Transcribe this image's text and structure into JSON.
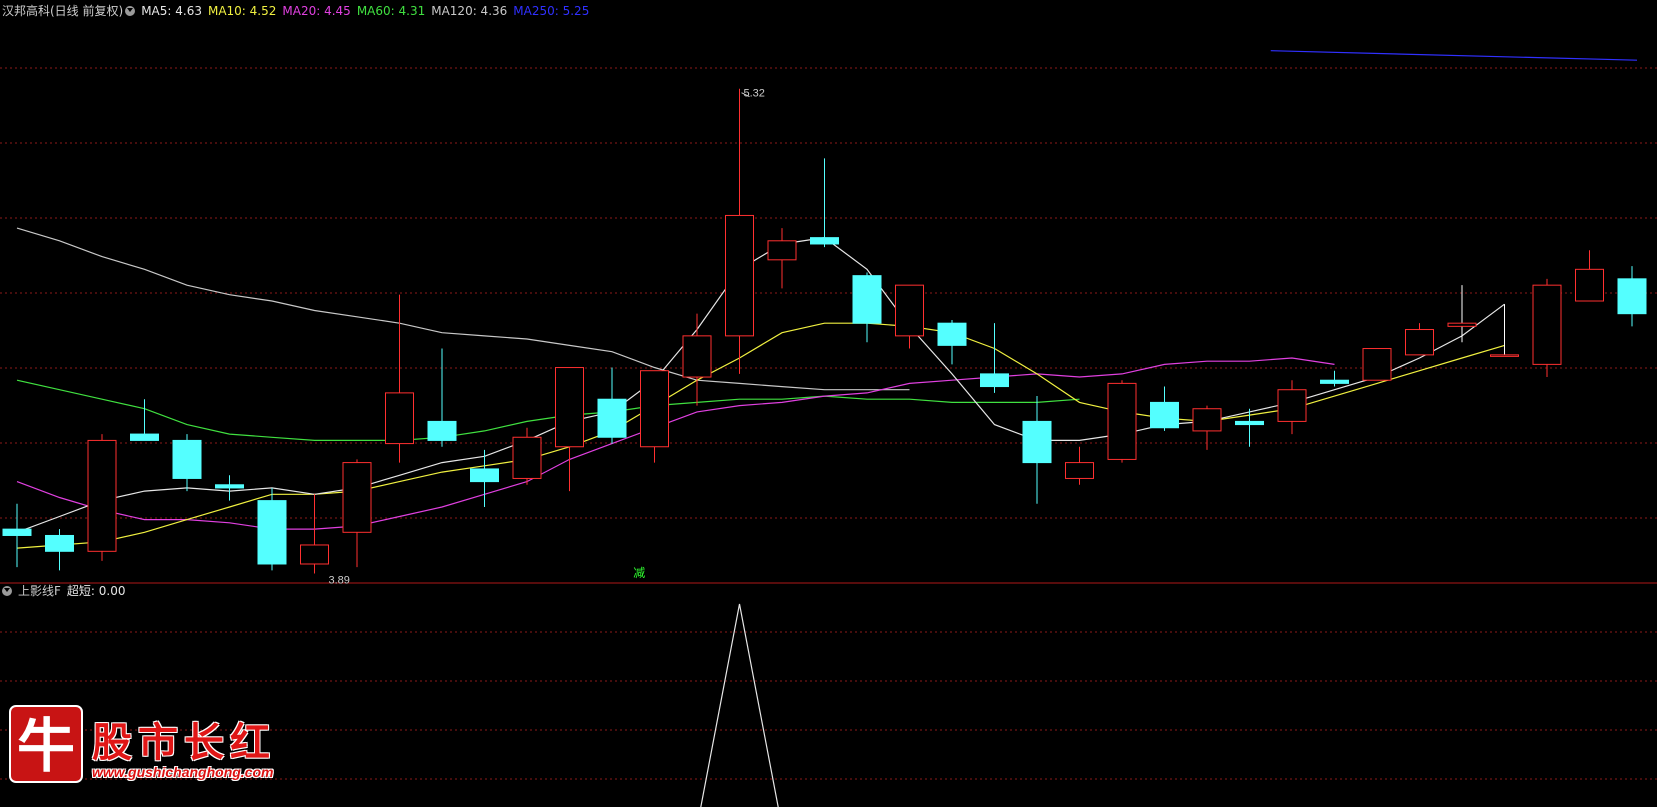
{
  "header": {
    "stock_name": "汉邦高科(日线 前复权)",
    "ma": [
      {
        "label": "MA5: 4.63",
        "color": "#e6e6e6"
      },
      {
        "label": "MA10: 4.52",
        "color": "#f0f040"
      },
      {
        "label": "MA20: 4.45",
        "color": "#e040e0"
      },
      {
        "label": "MA60: 4.31",
        "color": "#40e040"
      },
      {
        "label": "MA120: 4.36",
        "color": "#c8c8c8"
      },
      {
        "label": "MA250: 5.25",
        "color": "#3030ff"
      }
    ]
  },
  "sub_header": {
    "indicator": "上影线F",
    "value_label": "超短: 0.00"
  },
  "annotations": {
    "high_label": "5.32",
    "low_label": "3.89",
    "signal_label": "减"
  },
  "colors": {
    "up": "#ff3030",
    "down": "#54ffff",
    "grid": "#8b1a1a",
    "separator": "#b01818"
  },
  "logo": {
    "name": "股市长红",
    "url": "www.gushichanghong.com",
    "char": "牛"
  },
  "chart_data": {
    "type": "candlestick",
    "candles": [
      {
        "o": 3.93,
        "h": 4.01,
        "l": 3.81,
        "c": 3.91
      },
      {
        "o": 3.91,
        "h": 3.93,
        "l": 3.8,
        "c": 3.86
      },
      {
        "o": 3.86,
        "h": 4.23,
        "l": 3.83,
        "c": 4.21
      },
      {
        "o": 4.23,
        "h": 4.34,
        "l": 4.22,
        "c": 4.21
      },
      {
        "o": 4.21,
        "h": 4.23,
        "l": 4.05,
        "c": 4.09
      },
      {
        "o": 4.07,
        "h": 4.1,
        "l": 4.02,
        "c": 4.06
      },
      {
        "o": 4.02,
        "h": 4.06,
        "l": 3.8,
        "c": 3.82
      },
      {
        "o": 3.82,
        "h": 4.04,
        "l": 3.79,
        "c": 3.88
      },
      {
        "o": 3.92,
        "h": 4.15,
        "l": 3.81,
        "c": 4.14
      },
      {
        "o": 4.2,
        "h": 4.67,
        "l": 4.14,
        "c": 4.36
      },
      {
        "o": 4.27,
        "h": 4.5,
        "l": 4.19,
        "c": 4.21
      },
      {
        "o": 4.12,
        "h": 4.18,
        "l": 4.0,
        "c": 4.08
      },
      {
        "o": 4.09,
        "h": 4.25,
        "l": 4.07,
        "c": 4.22
      },
      {
        "o": 4.19,
        "h": 4.43,
        "l": 4.05,
        "c": 4.44
      },
      {
        "o": 4.34,
        "h": 4.44,
        "l": 4.2,
        "c": 4.22
      },
      {
        "o": 4.19,
        "h": 4.43,
        "l": 4.14,
        "c": 4.43
      },
      {
        "o": 4.41,
        "h": 4.61,
        "l": 4.32,
        "c": 4.54
      },
      {
        "o": 4.54,
        "h": 5.32,
        "l": 4.42,
        "c": 4.92
      },
      {
        "o": 4.78,
        "h": 4.88,
        "l": 4.69,
        "c": 4.84
      },
      {
        "o": 4.85,
        "h": 5.1,
        "l": 4.82,
        "c": 4.83
      },
      {
        "o": 4.73,
        "h": 4.74,
        "l": 4.52,
        "c": 4.58
      },
      {
        "o": 4.54,
        "h": 4.63,
        "l": 4.5,
        "c": 4.7
      },
      {
        "o": 4.58,
        "h": 4.59,
        "l": 4.45,
        "c": 4.51
      },
      {
        "o": 4.42,
        "h": 4.58,
        "l": 4.36,
        "c": 4.38
      },
      {
        "o": 4.27,
        "h": 4.35,
        "l": 4.01,
        "c": 4.14
      },
      {
        "o": 4.09,
        "h": 4.19,
        "l": 4.07,
        "c": 4.14
      },
      {
        "o": 4.15,
        "h": 4.4,
        "l": 4.14,
        "c": 4.39
      },
      {
        "o": 4.33,
        "h": 4.38,
        "l": 4.24,
        "c": 4.25
      },
      {
        "o": 4.24,
        "h": 4.32,
        "l": 4.18,
        "c": 4.31
      },
      {
        "o": 4.27,
        "h": 4.31,
        "l": 4.19,
        "c": 4.26
      },
      {
        "o": 4.27,
        "h": 4.4,
        "l": 4.23,
        "c": 4.37
      },
      {
        "o": 4.4,
        "h": 4.43,
        "l": 4.38,
        "c": 4.39
      },
      {
        "o": 4.4,
        "h": 4.5,
        "l": 4.43,
        "c": 4.5
      },
      {
        "o": 4.48,
        "h": 4.58,
        "l": 4.56,
        "c": 4.56
      },
      {
        "o": 4.57,
        "h": 4.7,
        "l": 4.52,
        "c": 4.58
      },
      {
        "o": 4.48,
        "h": 4.64,
        "l": 4.48,
        "c": 4.48
      },
      {
        "o": 4.45,
        "h": 4.72,
        "l": 4.41,
        "c": 4.7
      },
      {
        "o": 4.65,
        "h": 4.81,
        "l": 4.66,
        "c": 4.75
      },
      {
        "o": 4.72,
        "h": 4.76,
        "l": 4.57,
        "c": 4.61
      }
    ],
    "ma5": [
      3.92,
      3.97,
      4.02,
      4.05,
      4.06,
      4.05,
      4.06,
      4.04,
      4.06,
      4.1,
      4.14,
      4.16,
      4.21,
      4.27,
      4.3,
      4.4,
      4.56,
      4.75,
      4.83,
      4.85,
      4.75,
      4.57,
      4.42,
      4.26,
      4.21,
      4.21,
      4.23,
      4.26,
      4.27,
      4.3,
      4.33,
      4.37,
      4.41,
      4.47,
      4.54,
      4.64
    ],
    "ma10": [
      3.87,
      3.88,
      3.89,
      3.92,
      3.96,
      4.0,
      4.04,
      4.04,
      4.05,
      4.08,
      4.11,
      4.13,
      4.15,
      4.19,
      4.24,
      4.32,
      4.4,
      4.47,
      4.55,
      4.58,
      4.58,
      4.57,
      4.55,
      4.5,
      4.42,
      4.33,
      4.3,
      4.28,
      4.27,
      4.29,
      4.31,
      4.35,
      4.39,
      4.43,
      4.47,
      4.51
    ],
    "ma20": [
      4.08,
      4.03,
      3.99,
      3.96,
      3.96,
      3.95,
      3.93,
      3.93,
      3.94,
      3.97,
      4.0,
      4.04,
      4.08,
      4.15,
      4.2,
      4.25,
      4.3,
      4.32,
      4.33,
      4.35,
      4.36,
      4.39,
      4.4,
      4.41,
      4.42,
      4.41,
      4.42,
      4.45,
      4.46,
      4.46,
      4.47,
      4.45
    ],
    "ma60": [
      4.4,
      4.37,
      4.34,
      4.31,
      4.26,
      4.23,
      4.22,
      4.21,
      4.21,
      4.21,
      4.22,
      4.24,
      4.27,
      4.29,
      4.3,
      4.32,
      4.33,
      4.34,
      4.34,
      4.35,
      4.34,
      4.34,
      4.33,
      4.33,
      4.33,
      4.34
    ],
    "ma120": [
      4.88,
      4.84,
      4.79,
      4.75,
      4.7,
      4.67,
      4.65,
      4.62,
      4.6,
      4.58,
      4.55,
      4.54,
      4.53,
      4.51,
      4.49,
      4.44,
      4.4,
      4.39,
      4.38,
      4.37,
      4.37,
      4.37
    ],
    "ma250": [
      5.44,
      5.41
    ],
    "upper_shadow": [
      0,
      0,
      0,
      0,
      0,
      0,
      0,
      0,
      0,
      0,
      0,
      0,
      0,
      0,
      0,
      0,
      0,
      1,
      0,
      0,
      0,
      0,
      0,
      0,
      0,
      0,
      0,
      0,
      0,
      0,
      0,
      0,
      0,
      0,
      0,
      0,
      0,
      0,
      0
    ]
  }
}
